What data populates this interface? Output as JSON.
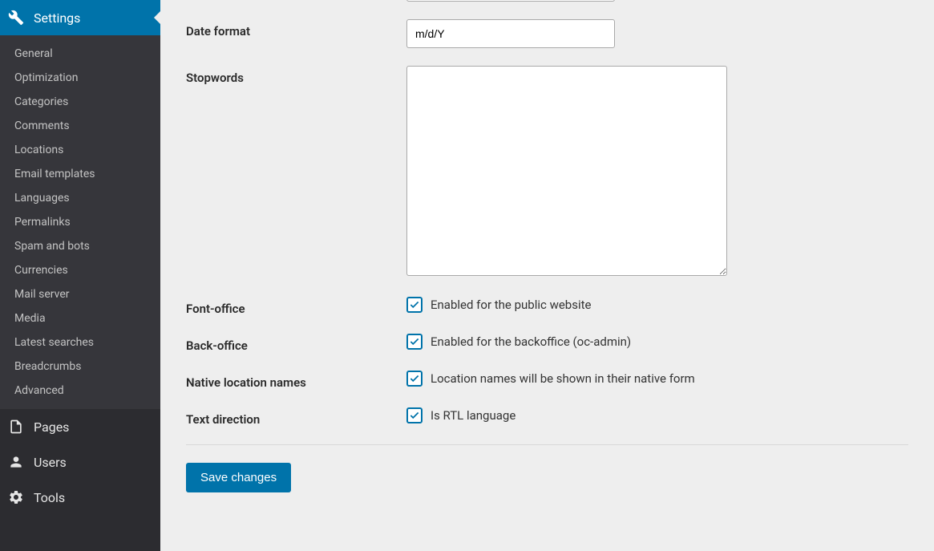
{
  "sidebar": {
    "settings_label": "Settings",
    "submenu": [
      "General",
      "Optimization",
      "Categories",
      "Comments",
      "Locations",
      "Email templates",
      "Languages",
      "Permalinks",
      "Spam and bots",
      "Currencies",
      "Mail server",
      "Media",
      "Latest searches",
      "Breadcrumbs",
      "Advanced"
    ],
    "pages_label": "Pages",
    "users_label": "Users",
    "tools_label": "Tools"
  },
  "form": {
    "prev_field": {
      "value": ""
    },
    "date_format": {
      "label": "Date format",
      "value": "m/d/Y"
    },
    "stopwords": {
      "label": "Stopwords",
      "value": ""
    },
    "front_office": {
      "label": "Font-office",
      "checkbox_label": "Enabled for the public website",
      "checked": true
    },
    "back_office": {
      "label": "Back-office",
      "checkbox_label": "Enabled for the backoffice (oc-admin)",
      "checked": true
    },
    "native_location": {
      "label": "Native location names",
      "checkbox_label": "Location names will be shown in their native form",
      "checked": true
    },
    "text_direction": {
      "label": "Text direction",
      "checkbox_label": "Is RTL language",
      "checked": true
    },
    "save_button": "Save changes"
  }
}
